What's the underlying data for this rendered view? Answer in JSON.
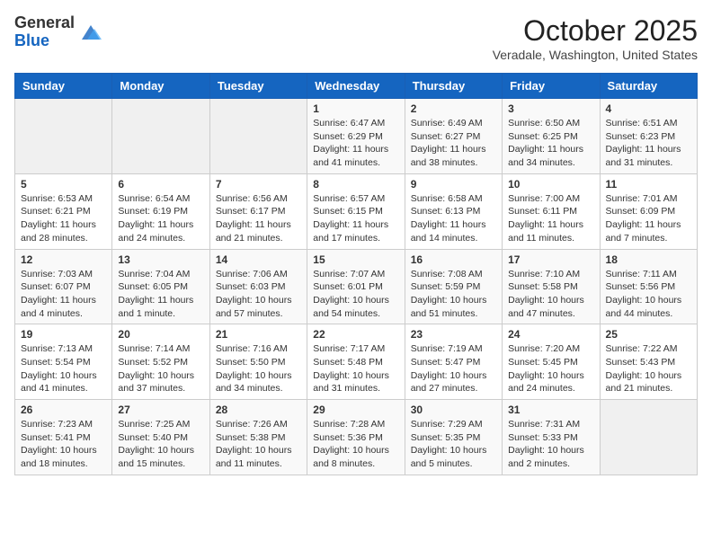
{
  "header": {
    "logo_general": "General",
    "logo_blue": "Blue",
    "month_title": "October 2025",
    "location": "Veradale, Washington, United States"
  },
  "days_of_week": [
    "Sunday",
    "Monday",
    "Tuesday",
    "Wednesday",
    "Thursday",
    "Friday",
    "Saturday"
  ],
  "weeks": [
    [
      {
        "day": "",
        "info": ""
      },
      {
        "day": "",
        "info": ""
      },
      {
        "day": "",
        "info": ""
      },
      {
        "day": "1",
        "info": "Sunrise: 6:47 AM\nSunset: 6:29 PM\nDaylight: 11 hours\nand 41 minutes."
      },
      {
        "day": "2",
        "info": "Sunrise: 6:49 AM\nSunset: 6:27 PM\nDaylight: 11 hours\nand 38 minutes."
      },
      {
        "day": "3",
        "info": "Sunrise: 6:50 AM\nSunset: 6:25 PM\nDaylight: 11 hours\nand 34 minutes."
      },
      {
        "day": "4",
        "info": "Sunrise: 6:51 AM\nSunset: 6:23 PM\nDaylight: 11 hours\nand 31 minutes."
      }
    ],
    [
      {
        "day": "5",
        "info": "Sunrise: 6:53 AM\nSunset: 6:21 PM\nDaylight: 11 hours\nand 28 minutes."
      },
      {
        "day": "6",
        "info": "Sunrise: 6:54 AM\nSunset: 6:19 PM\nDaylight: 11 hours\nand 24 minutes."
      },
      {
        "day": "7",
        "info": "Sunrise: 6:56 AM\nSunset: 6:17 PM\nDaylight: 11 hours\nand 21 minutes."
      },
      {
        "day": "8",
        "info": "Sunrise: 6:57 AM\nSunset: 6:15 PM\nDaylight: 11 hours\nand 17 minutes."
      },
      {
        "day": "9",
        "info": "Sunrise: 6:58 AM\nSunset: 6:13 PM\nDaylight: 11 hours\nand 14 minutes."
      },
      {
        "day": "10",
        "info": "Sunrise: 7:00 AM\nSunset: 6:11 PM\nDaylight: 11 hours\nand 11 minutes."
      },
      {
        "day": "11",
        "info": "Sunrise: 7:01 AM\nSunset: 6:09 PM\nDaylight: 11 hours\nand 7 minutes."
      }
    ],
    [
      {
        "day": "12",
        "info": "Sunrise: 7:03 AM\nSunset: 6:07 PM\nDaylight: 11 hours\nand 4 minutes."
      },
      {
        "day": "13",
        "info": "Sunrise: 7:04 AM\nSunset: 6:05 PM\nDaylight: 11 hours\nand 1 minute."
      },
      {
        "day": "14",
        "info": "Sunrise: 7:06 AM\nSunset: 6:03 PM\nDaylight: 10 hours\nand 57 minutes."
      },
      {
        "day": "15",
        "info": "Sunrise: 7:07 AM\nSunset: 6:01 PM\nDaylight: 10 hours\nand 54 minutes."
      },
      {
        "day": "16",
        "info": "Sunrise: 7:08 AM\nSunset: 5:59 PM\nDaylight: 10 hours\nand 51 minutes."
      },
      {
        "day": "17",
        "info": "Sunrise: 7:10 AM\nSunset: 5:58 PM\nDaylight: 10 hours\nand 47 minutes."
      },
      {
        "day": "18",
        "info": "Sunrise: 7:11 AM\nSunset: 5:56 PM\nDaylight: 10 hours\nand 44 minutes."
      }
    ],
    [
      {
        "day": "19",
        "info": "Sunrise: 7:13 AM\nSunset: 5:54 PM\nDaylight: 10 hours\nand 41 minutes."
      },
      {
        "day": "20",
        "info": "Sunrise: 7:14 AM\nSunset: 5:52 PM\nDaylight: 10 hours\nand 37 minutes."
      },
      {
        "day": "21",
        "info": "Sunrise: 7:16 AM\nSunset: 5:50 PM\nDaylight: 10 hours\nand 34 minutes."
      },
      {
        "day": "22",
        "info": "Sunrise: 7:17 AM\nSunset: 5:48 PM\nDaylight: 10 hours\nand 31 minutes."
      },
      {
        "day": "23",
        "info": "Sunrise: 7:19 AM\nSunset: 5:47 PM\nDaylight: 10 hours\nand 27 minutes."
      },
      {
        "day": "24",
        "info": "Sunrise: 7:20 AM\nSunset: 5:45 PM\nDaylight: 10 hours\nand 24 minutes."
      },
      {
        "day": "25",
        "info": "Sunrise: 7:22 AM\nSunset: 5:43 PM\nDaylight: 10 hours\nand 21 minutes."
      }
    ],
    [
      {
        "day": "26",
        "info": "Sunrise: 7:23 AM\nSunset: 5:41 PM\nDaylight: 10 hours\nand 18 minutes."
      },
      {
        "day": "27",
        "info": "Sunrise: 7:25 AM\nSunset: 5:40 PM\nDaylight: 10 hours\nand 15 minutes."
      },
      {
        "day": "28",
        "info": "Sunrise: 7:26 AM\nSunset: 5:38 PM\nDaylight: 10 hours\nand 11 minutes."
      },
      {
        "day": "29",
        "info": "Sunrise: 7:28 AM\nSunset: 5:36 PM\nDaylight: 10 hours\nand 8 minutes."
      },
      {
        "day": "30",
        "info": "Sunrise: 7:29 AM\nSunset: 5:35 PM\nDaylight: 10 hours\nand 5 minutes."
      },
      {
        "day": "31",
        "info": "Sunrise: 7:31 AM\nSunset: 5:33 PM\nDaylight: 10 hours\nand 2 minutes."
      },
      {
        "day": "",
        "info": ""
      }
    ]
  ]
}
